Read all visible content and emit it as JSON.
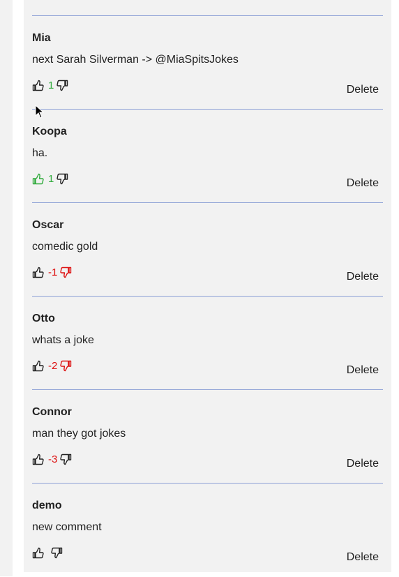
{
  "comments": [
    {
      "author": "Mia",
      "text": "next Sarah Silverman -> @MiaSpitsJokes",
      "score": "1",
      "score_color": "#2eaa3a",
      "up_color": "#222222",
      "down_color": "#222222",
      "delete_label": "Delete"
    },
    {
      "author": "Koopa",
      "text": "ha.",
      "score": "1",
      "score_color": "#2eaa3a",
      "up_color": "#2eaa3a",
      "down_color": "#222222",
      "delete_label": "Delete"
    },
    {
      "author": "Oscar",
      "text": "comedic gold",
      "score": "-1",
      "score_color": "#dd1111",
      "up_color": "#222222",
      "down_color": "#dd1111",
      "delete_label": "Delete"
    },
    {
      "author": "Otto",
      "text": "whats a joke",
      "score": "-2",
      "score_color": "#dd1111",
      "up_color": "#222222",
      "down_color": "#dd1111",
      "delete_label": "Delete"
    },
    {
      "author": "Connor",
      "text": "man they got jokes",
      "score": "-3",
      "score_color": "#dd1111",
      "up_color": "#222222",
      "down_color": "#222222",
      "delete_label": "Delete"
    },
    {
      "author": "demo",
      "text": "new comment",
      "score": "",
      "score_color": "#222222",
      "up_color": "#222222",
      "down_color": "#222222",
      "delete_label": "Delete"
    }
  ],
  "icons": {
    "upvote": "thumbs-up-icon",
    "downvote": "thumbs-down-icon",
    "cursor": "mouse-pointer-icon"
  }
}
